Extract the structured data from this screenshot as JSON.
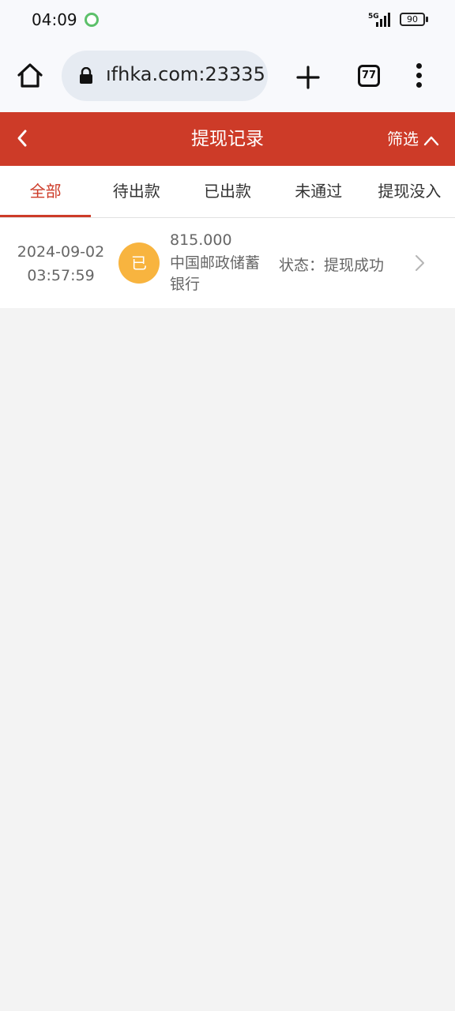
{
  "status_bar": {
    "time": "04:09",
    "network": "5G",
    "battery": "90"
  },
  "browser": {
    "url": "ıfhka.com:23335",
    "tab_count": "77"
  },
  "header": {
    "title": "提现记录",
    "filter_label": "筛选"
  },
  "tabs": [
    {
      "label": "全部",
      "active": true
    },
    {
      "label": "待出款",
      "active": false
    },
    {
      "label": "已出款",
      "active": false
    },
    {
      "label": "未通过",
      "active": false
    },
    {
      "label": "提现没入",
      "active": false
    }
  ],
  "records": [
    {
      "date": "2024-09-02",
      "time": "03:57:59",
      "badge": "已",
      "amount": "815.000",
      "bank": "中国邮政储蓄银行",
      "status": "状态：提现成功"
    }
  ],
  "colors": {
    "accent": "#cd3b28",
    "badge": "#f8b43f",
    "background": "#f3f3f3"
  }
}
